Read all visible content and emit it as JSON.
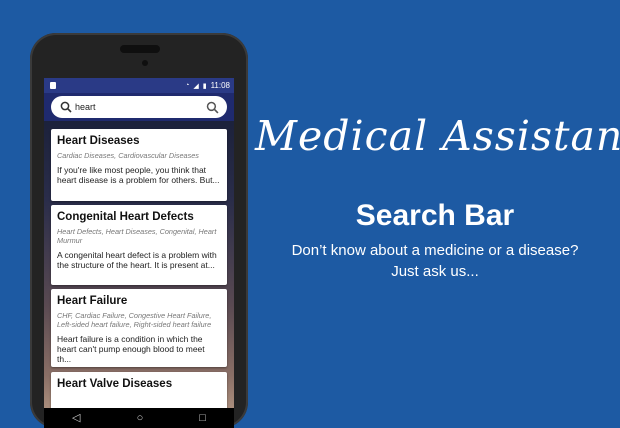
{
  "app": {
    "headline": "Medical Assistant",
    "feature_title": "Search Bar",
    "tagline_line1": "Don’t know about a medicine or a disease?",
    "tagline_line2": "Just ask us..."
  },
  "status_bar": {
    "time": "11:08"
  },
  "search": {
    "query": "heart"
  },
  "results": [
    {
      "title": "Heart Diseases",
      "tags": "Cardiac Diseases, Cardiovascular Diseases",
      "description": "If you're like most people, you think that heart disease is a problem for others. But..."
    },
    {
      "title": "Congenital Heart Defects",
      "tags": "Heart Defects, Heart Diseases, Congenital, Heart Murmur",
      "description": "A congenital heart defect is a problem with the structure of the heart. It is present at..."
    },
    {
      "title": "Heart Failure",
      "tags": "CHF, Cardiac Failure, Congestive Heart Failure, Left-sided heart failure, Right-sided heart failure",
      "description": "Heart failure is a condition in which the heart can't pump enough blood to meet th..."
    },
    {
      "title": "Heart Valve Diseases"
    }
  ],
  "colors": {
    "background": "#1d5aa3",
    "status_bar": "#2a3a86",
    "search_bar": "#1f2a6e"
  },
  "icons": {
    "search": "magnifier-icon",
    "nav_back": "back-icon",
    "nav_home": "home-icon",
    "nav_recent": "recent-apps-icon"
  }
}
